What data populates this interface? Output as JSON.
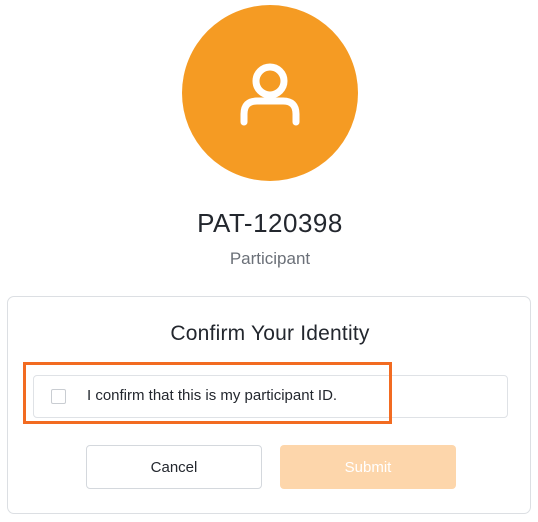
{
  "profile": {
    "participant_id": "PAT-120398",
    "role": "Participant",
    "avatar_icon": "user-icon",
    "avatar_color": "#f59b23"
  },
  "confirm_card": {
    "title": "Confirm Your Identity",
    "checkbox_label": "I confirm that this is my participant ID.",
    "checkbox_checked": false,
    "cancel_label": "Cancel",
    "submit_label": "Submit",
    "submit_disabled": true,
    "submit_color": "#fdd6ab",
    "highlight_color": "#f26b21"
  }
}
